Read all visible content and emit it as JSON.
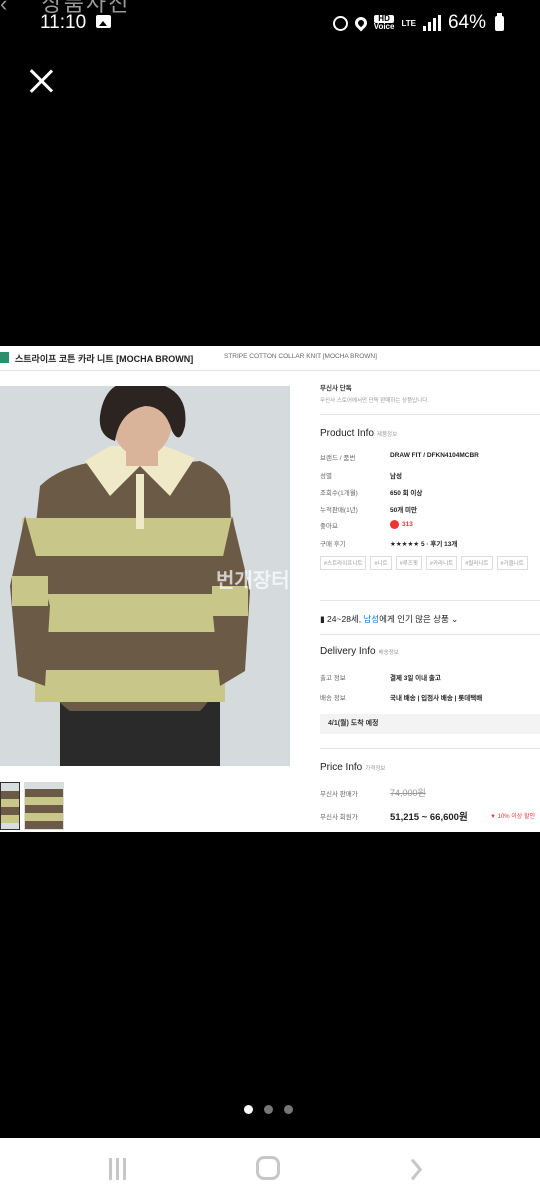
{
  "status_bar": {
    "time": "11:10",
    "battery": "64%",
    "network": "LTE",
    "hd_label": "HD",
    "hd_sub": "Voice",
    "icons": [
      "gallery-icon",
      "alarm-icon",
      "location-icon",
      "hd-voice-icon",
      "lte-icon",
      "signal-icon",
      "battery-icon"
    ]
  },
  "behind_header": {
    "title": "상품사진"
  },
  "viewer": {
    "close_icon": "close-icon",
    "page_count": 3,
    "current_page": 1
  },
  "product_page": {
    "title_kr": "스트라이프 코튼 카라 니트 [MOCHA BROWN]",
    "title_en": "STRIPE COTTON COLLAR KNIT [MOCHA BROWN]",
    "exclusive": "무신사 단독",
    "exclusive_desc": "무신사 스토어에서만 단독 판매하는 상품입니다.",
    "product_info_title": "Product Info",
    "product_info_sub": "제품정보",
    "rows": [
      {
        "key": "브랜드 / 품번",
        "value": "DRAW FIT / DFKN4104MCBR"
      },
      {
        "key": "성별",
        "value": "남성"
      },
      {
        "key": "조회수(1개월)",
        "value": "650 회 이상"
      },
      {
        "key": "누적판매(1년)",
        "value": "50개 미만"
      },
      {
        "key": "좋아요",
        "value": "313"
      },
      {
        "key": "구매 후기",
        "value": "★★★★★ 5 · 후기 13개"
      }
    ],
    "tags": [
      "#스트라이프니트",
      "#니트",
      "#루즈핏",
      "#카라니트",
      "#컬러니트",
      "#가을니트"
    ],
    "age_text_1": "24~28세,",
    "age_highlight": "남성",
    "age_text_2": "에게 인기 많은 상품",
    "delivery_title": "Delivery Info",
    "delivery_sub": "배송정보",
    "delivery_rows": [
      {
        "key": "출고 정보",
        "value": "결제 3일 이내 출고"
      },
      {
        "key": "배송 정보",
        "value": "국내 배송 | 입점사 배송 | 롯데택배"
      }
    ],
    "arrival": "4/1(월) 도착 예정",
    "price_title": "Price Info",
    "price_sub": "가격정보",
    "price_rows": [
      {
        "key": "무신사 판매가",
        "value": "74,000원"
      },
      {
        "key": "무신사 회원가",
        "value": "51,215 ~ 66,600원"
      }
    ],
    "discount": "10% 이상 할인",
    "watermark": "번개장터",
    "colors": {
      "stripe_brown": "#6b5a45",
      "stripe_yellow": "#c9c68a",
      "collar": "#efe9c8",
      "accent_red": "#e33333",
      "accent_blue": "#1a6fd1"
    }
  }
}
